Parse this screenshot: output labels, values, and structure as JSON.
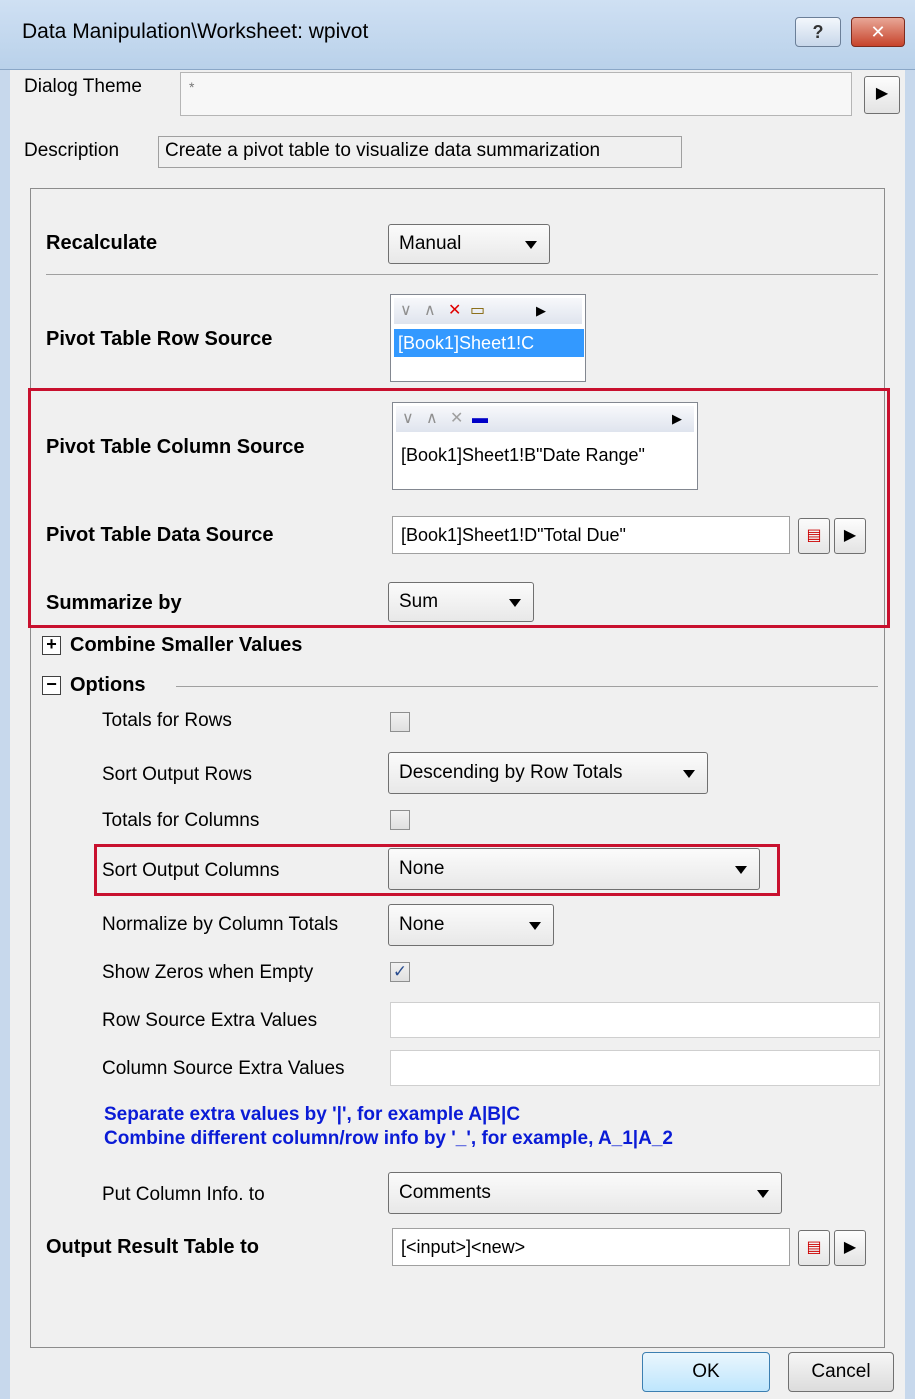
{
  "window": {
    "title": "Data Manipulation\\Worksheet: wpivot",
    "help_label": "?",
    "close_label": "✕"
  },
  "theme": {
    "label": "Dialog Theme",
    "value": "*",
    "arrow_label": "▶"
  },
  "description": {
    "label": "Description",
    "value": "Create a pivot table to visualize data summarization"
  },
  "recalculate": {
    "label": "Recalculate",
    "value": "Manual"
  },
  "row_source": {
    "label": "Pivot Table Row Source",
    "value": "[Book1]Sheet1!C",
    "toolbar": {
      "down": "∨",
      "up": "∧",
      "delete": "✕",
      "rect": "▭",
      "arrow": "▶"
    }
  },
  "column_source": {
    "label": "Pivot Table Column Source",
    "value": "[Book1]Sheet1!B\"Date Range\"",
    "toolbar": {
      "down": "∨",
      "up": "∧",
      "delete": "✕",
      "rect": "▬",
      "arrow": "▶"
    }
  },
  "data_source": {
    "label": "Pivot Table Data Source",
    "value": "[Book1]Sheet1!D\"Total Due\"",
    "arrow_label": "▶"
  },
  "summarize": {
    "label": "Summarize by",
    "value": "Sum"
  },
  "combine": {
    "toggle": "+",
    "label": "Combine Smaller Values"
  },
  "options": {
    "toggle": "−",
    "label": "Options",
    "totals_rows_label": "Totals for Rows",
    "totals_rows_checked": false,
    "sort_rows_label": "Sort Output Rows",
    "sort_rows_value": "Descending by Row Totals",
    "totals_cols_label": "Totals for Columns",
    "totals_cols_checked": false,
    "sort_cols_label": "Sort Output Columns",
    "sort_cols_value": "None",
    "normalize_label": "Normalize by Column Totals",
    "normalize_value": "None",
    "zeros_label": "Show Zeros when Empty",
    "zeros_checked": true,
    "zeros_mark": "✓",
    "row_extra_label": "Row Source Extra Values",
    "row_extra_value": "",
    "col_extra_label": "Column Source Extra Values",
    "col_extra_value": "",
    "note_1": "Separate extra values by '|', for example A|B|C",
    "note_2": "Combine different column/row info by '_', for example, A_1|A_2",
    "col_info_label": "Put Column Info. to",
    "col_info_value": "Comments"
  },
  "output": {
    "label": "Output Result Table to",
    "value": "[<input>]<new>",
    "arrow_label": "▶"
  },
  "buttons": {
    "ok": "OK",
    "cancel": "Cancel"
  },
  "colors": {
    "highlight": "#c8102e",
    "selection": "#3399ff",
    "note_text": "#0a1bd6"
  }
}
